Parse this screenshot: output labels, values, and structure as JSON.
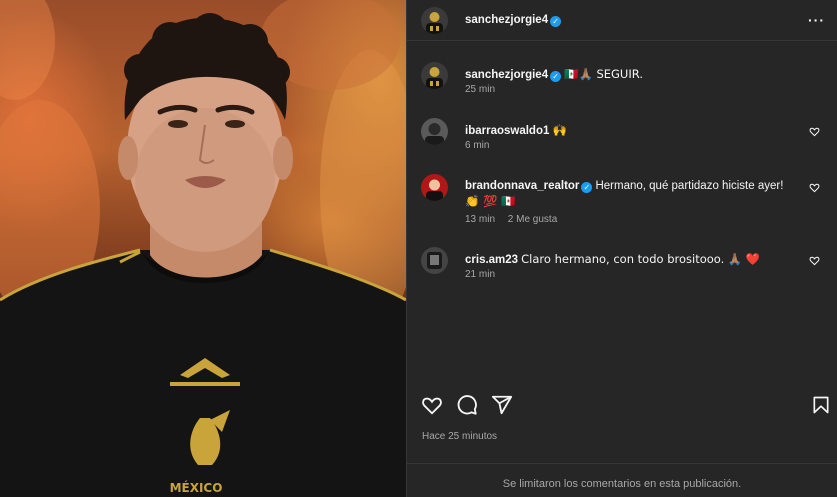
{
  "photo": {
    "jersey_wordmark": "MÉXICO"
  },
  "header": {
    "username": "sanchezjorgie4"
  },
  "caption": {
    "username": "sanchezjorgie4",
    "text": "🇲🇽🙏🏽 SEGUIR.",
    "time": "25 min"
  },
  "comments": [
    {
      "username": "ibarraoswaldo1",
      "text": "🙌",
      "time": "6 min",
      "likes": ""
    },
    {
      "username": "brandonnava_realtor",
      "text": "Hermano, qué partidazo hiciste ayer!",
      "text2": "👏 💯 🇲🇽",
      "time": "13 min",
      "likes": "2 Me gusta"
    },
    {
      "username": "cris.am23",
      "text": "Claro hermano, con todo brositooo. 🙏🏽 ❤️",
      "time": "21 min",
      "likes": ""
    }
  ],
  "actions": {
    "like": "heart-icon",
    "comment": "comment-icon",
    "share": "share-icon",
    "save": "bookmark-icon"
  },
  "timestamp": "Hace 25 minutos",
  "comments_limited": "Se limitaron los comentarios en esta publicación.",
  "colors": {
    "panel_bg": "#262626",
    "verified": "#1d9bf0",
    "muted_text": "#a8a8a8"
  }
}
